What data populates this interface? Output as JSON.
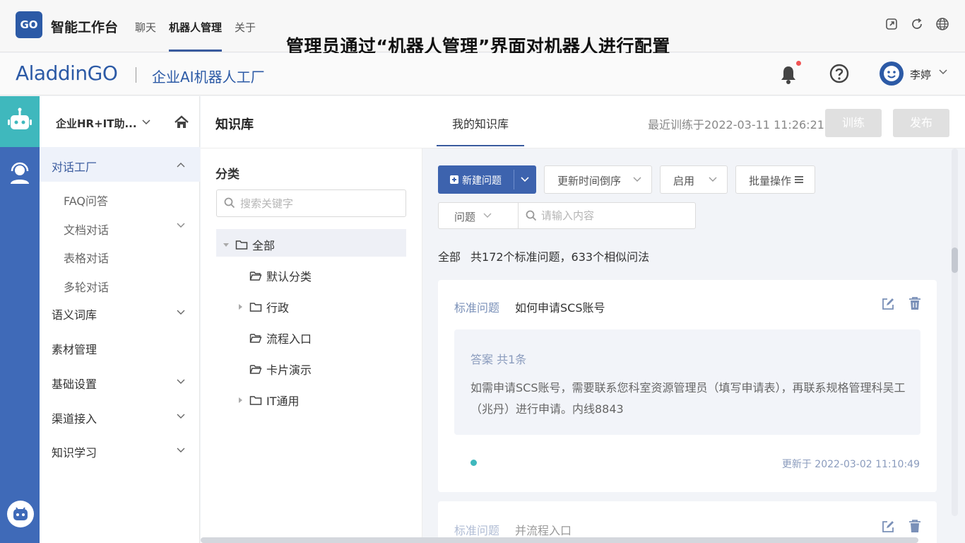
{
  "topbar": {
    "logo_text": "GO",
    "app_title": "智能工作台",
    "nav": [
      "聊天",
      "机器人管理",
      "关于"
    ],
    "active_nav": "机器人管理",
    "banner": "管理员通过“机器人管理”界面对机器人进行配置",
    "icons": [
      "external-link-icon",
      "refresh-icon",
      "globe-icon"
    ]
  },
  "header": {
    "brand": "AladdinGO",
    "subtitle": "企业AI机器人工厂",
    "user_name": "李婷",
    "icons": [
      "bell-icon",
      "help-icon",
      "avatar",
      "chevron-down-icon"
    ]
  },
  "sidebar": {
    "bot_name": "企业HR+IT助...",
    "menu": {
      "dialog_factory": "对话工厂",
      "sub_items": [
        "FAQ问答",
        "文档对话",
        "表格对话",
        "多轮对话"
      ],
      "semantic_lexicon": "语义词库",
      "material": "素材管理",
      "basic_settings": "基础设置",
      "channels": "渠道接入",
      "learning": "知识学习"
    }
  },
  "main": {
    "title": "知识库",
    "tab": "我的知识库",
    "last_train": "最近训练于2022-03-11 11:26:21",
    "train_button": "训练",
    "publish_button": "发布"
  },
  "categories": {
    "title": "分类",
    "search_placeholder": "搜索关键字",
    "tree": [
      {
        "label": "全部",
        "level": 0,
        "expanded": true,
        "selected": true
      },
      {
        "label": "默认分类",
        "level": 1,
        "expandable": false
      },
      {
        "label": "行政",
        "level": 1,
        "expandable": true
      },
      {
        "label": "流程入口",
        "level": 1,
        "expandable": false
      },
      {
        "label": "卡片演示",
        "level": 1,
        "expandable": false
      },
      {
        "label": "IT通用",
        "level": 1,
        "expandable": true
      }
    ]
  },
  "toolbar": {
    "new_question": "新建问题",
    "sort": "更新时间倒序",
    "status": "启用",
    "batch": "批量操作",
    "search_type": "问题",
    "search_placeholder": "请输入内容"
  },
  "summary": {
    "scope": "全部",
    "count_text": "共172个标准问题，633个相似问法"
  },
  "questions": [
    {
      "label": "标准问题",
      "text": "如何申请SCS账号",
      "answer_title": "答案 共1条",
      "answer": "如需申请SCS账号，需要联系您科室资源管理员（填写申请表），再联系规格管理科吴工（兆丹）进行申请。内线8843",
      "status_color": "#3fb8bd",
      "updated": "更新于 2022-03-02 11:10:49"
    },
    {
      "label": "标准问题",
      "text": "并流程入口"
    }
  ],
  "colors": {
    "primary": "#3d63ae",
    "rail": "#3f6ab8",
    "rail_active": "#3fb8bd",
    "disabled": "#e0e0e0"
  }
}
